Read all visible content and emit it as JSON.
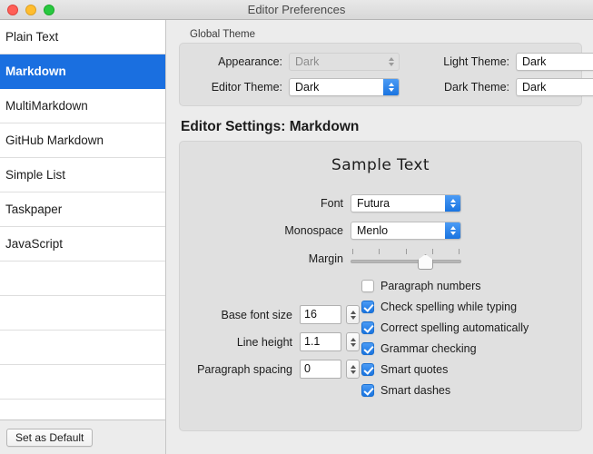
{
  "window": {
    "title": "Editor Preferences",
    "traffic_lights": [
      "close-button",
      "minimize-button",
      "maximize-button"
    ]
  },
  "sidebar": {
    "items": [
      {
        "label": "Plain Text",
        "selected": false
      },
      {
        "label": "Markdown",
        "selected": true
      },
      {
        "label": "MultiMarkdown",
        "selected": false
      },
      {
        "label": "GitHub Markdown",
        "selected": false
      },
      {
        "label": "Simple List",
        "selected": false
      },
      {
        "label": "Taskpaper",
        "selected": false
      },
      {
        "label": "JavaScript",
        "selected": false
      },
      {
        "label": "",
        "selected": false
      },
      {
        "label": "",
        "selected": false
      },
      {
        "label": "",
        "selected": false
      },
      {
        "label": "",
        "selected": false
      }
    ],
    "set_as_default_label": "Set as Default"
  },
  "global_theme": {
    "group_label": "Global Theme",
    "fields": [
      {
        "label": "Appearance:",
        "value": "Dark",
        "disabled": true
      },
      {
        "label": "Light Theme:",
        "value": "Dark",
        "disabled": false
      },
      {
        "label": "Editor Theme:",
        "value": "Dark",
        "disabled": false
      },
      {
        "label": "Dark Theme:",
        "value": "Dark",
        "disabled": false
      }
    ]
  },
  "editor_settings": {
    "title": "Editor Settings: Markdown",
    "sample_text": "Sample Text",
    "font": {
      "label": "Font",
      "value": "Futura"
    },
    "monospace": {
      "label": "Monospace",
      "value": "Menlo"
    },
    "margin": {
      "label": "Margin",
      "ticks": 5,
      "position": 4
    },
    "checkboxes": [
      {
        "label": "Paragraph numbers",
        "checked": false
      },
      {
        "label": "Check spelling while typing",
        "checked": true
      },
      {
        "label": "Correct spelling automatically",
        "checked": true
      },
      {
        "label": "Grammar checking",
        "checked": true
      },
      {
        "label": "Smart quotes",
        "checked": true
      },
      {
        "label": "Smart dashes",
        "checked": true
      }
    ],
    "numeric_fields": [
      {
        "label": "Base font size",
        "value": "16"
      },
      {
        "label": "Line height",
        "value": "1.1"
      },
      {
        "label": "Paragraph spacing",
        "value": "0"
      }
    ]
  },
  "colors": {
    "accent": "#1a6fe0",
    "window_bg": "#ececec",
    "group_bg": "#e0e0e0"
  }
}
